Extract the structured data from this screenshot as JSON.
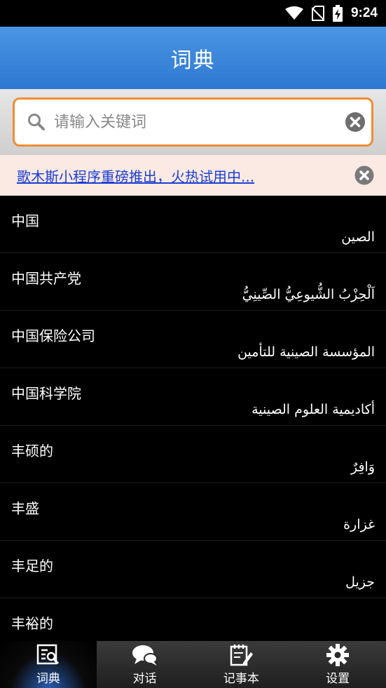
{
  "status_bar": {
    "time": "9:24",
    "icons": [
      "wifi-icon",
      "no-sim-icon",
      "battery-charging-icon"
    ]
  },
  "header": {
    "title": "词典"
  },
  "search": {
    "placeholder": "请输入关键词",
    "value": ""
  },
  "banner": {
    "text": "歌木斯小程序重磅推出，火热试用中..."
  },
  "entries": [
    {
      "zh": "中国",
      "ar": "الصين"
    },
    {
      "zh": "中国共产党",
      "ar": "اَلْحِزْبُ الشُّيوعِيُّ الصِّينِيُّ"
    },
    {
      "zh": "中国保险公司",
      "ar": "المؤسسة الصينية للتأمين"
    },
    {
      "zh": "中国科学院",
      "ar": "أكاديمية العلوم الصينية"
    },
    {
      "zh": "丰硕的",
      "ar": "وَافِرٌ"
    },
    {
      "zh": "丰盛",
      "ar": "غزارة"
    },
    {
      "zh": "丰足的",
      "ar": "جزيل"
    },
    {
      "zh": "丰裕的",
      "ar": ""
    }
  ],
  "tabs": [
    {
      "label": "词典",
      "icon": "dictionary-icon",
      "active": true
    },
    {
      "label": "对话",
      "icon": "chat-bubbles-icon",
      "active": false
    },
    {
      "label": "记事本",
      "icon": "notepad-icon",
      "active": false
    },
    {
      "label": "设置",
      "icon": "gear-icon",
      "active": false
    }
  ],
  "colors": {
    "header": "#2f78d2",
    "search_border": "#f08c35",
    "banner_bg": "#fbe9e3",
    "link": "#1a3fd6"
  }
}
